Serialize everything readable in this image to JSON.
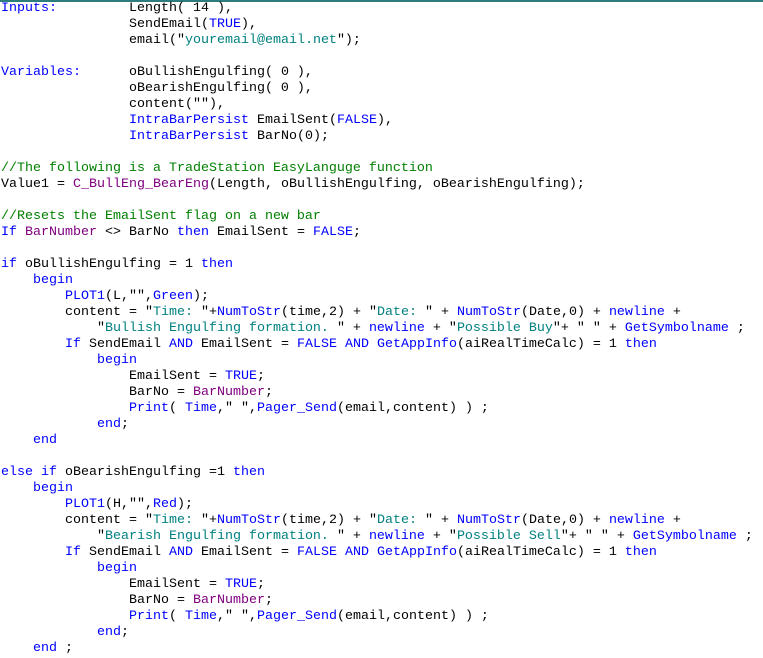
{
  "colors": {
    "keyword": "#0000ff",
    "string": "#008080",
    "comment": "#008000",
    "function": "#800080",
    "text": "#000000",
    "top_border": "#2e7d7d"
  },
  "code": {
    "lines": [
      [
        [
          "k",
          "Inputs:"
        ],
        [
          "t",
          "         Length( 14 ),"
        ]
      ],
      [
        [
          "t",
          "                SendEmail("
        ],
        [
          "k",
          "TRUE"
        ],
        [
          "t",
          "),"
        ]
      ],
      [
        [
          "t",
          "                email(\""
        ],
        [
          "s",
          "youremail@email.net"
        ],
        [
          "t",
          "\");"
        ]
      ],
      [],
      [
        [
          "k",
          "Variables:"
        ],
        [
          "t",
          "      oBullishEngulfing( 0 ),"
        ]
      ],
      [
        [
          "t",
          "                oBearishEngulfing( 0 ),"
        ]
      ],
      [
        [
          "t",
          "                content(\"\"),"
        ]
      ],
      [
        [
          "t",
          "                "
        ],
        [
          "k",
          "IntraBarPersist"
        ],
        [
          "t",
          " EmailSent("
        ],
        [
          "k",
          "FALSE"
        ],
        [
          "t",
          "),"
        ]
      ],
      [
        [
          "t",
          "                "
        ],
        [
          "k",
          "IntraBarPersist"
        ],
        [
          "t",
          " BarNo(0);"
        ]
      ],
      [],
      [
        [
          "c",
          "//The following is a TradeStation EasyLanguge function"
        ]
      ],
      [
        [
          "t",
          "Value1 = "
        ],
        [
          "f",
          "C_BullEng_BearEng"
        ],
        [
          "t",
          "(Length, oBullishEngulfing, oBearishEngulfing);"
        ]
      ],
      [],
      [
        [
          "c",
          "//Resets the EmailSent flag on a new bar"
        ]
      ],
      [
        [
          "k",
          "If"
        ],
        [
          "t",
          " "
        ],
        [
          "f",
          "BarNumber"
        ],
        [
          "t",
          " <> BarNo "
        ],
        [
          "k",
          "then"
        ],
        [
          "t",
          " EmailSent = "
        ],
        [
          "k",
          "FALSE"
        ],
        [
          "t",
          ";"
        ]
      ],
      [],
      [
        [
          "k",
          "if"
        ],
        [
          "t",
          " oBullishEngulfing = 1 "
        ],
        [
          "k",
          "then"
        ]
      ],
      [
        [
          "t",
          "    "
        ],
        [
          "k",
          "begin"
        ]
      ],
      [
        [
          "t",
          "        "
        ],
        [
          "k",
          "PLOT1"
        ],
        [
          "t",
          "(L,\"\","
        ],
        [
          "k",
          "Green"
        ],
        [
          "t",
          ");"
        ]
      ],
      [
        [
          "t",
          "        content = \""
        ],
        [
          "s",
          "Time: "
        ],
        [
          "t",
          "\"+"
        ],
        [
          "k",
          "NumToStr"
        ],
        [
          "t",
          "(time,2) + \""
        ],
        [
          "s",
          "Date: "
        ],
        [
          "t",
          "\" + "
        ],
        [
          "k",
          "NumToStr"
        ],
        [
          "t",
          "(Date,0) + "
        ],
        [
          "k",
          "newline"
        ],
        [
          "t",
          " +"
        ]
      ],
      [
        [
          "t",
          "            \""
        ],
        [
          "s",
          "Bullish Engulfing formation. "
        ],
        [
          "t",
          "\" + "
        ],
        [
          "k",
          "newline"
        ],
        [
          "t",
          " + \""
        ],
        [
          "s",
          "Possible Buy"
        ],
        [
          "t",
          "\"+ \" \" + "
        ],
        [
          "k",
          "GetSymbolname"
        ],
        [
          "t",
          " ;"
        ]
      ],
      [
        [
          "t",
          "        "
        ],
        [
          "k",
          "If"
        ],
        [
          "t",
          " SendEmail "
        ],
        [
          "k",
          "AND"
        ],
        [
          "t",
          " EmailSent = "
        ],
        [
          "k",
          "FALSE"
        ],
        [
          "t",
          " "
        ],
        [
          "k",
          "AND"
        ],
        [
          "t",
          " "
        ],
        [
          "k",
          "GetAppInfo"
        ],
        [
          "t",
          "(aiRealTimeCalc) = 1 "
        ],
        [
          "k",
          "then"
        ]
      ],
      [
        [
          "t",
          "            "
        ],
        [
          "k",
          "begin"
        ]
      ],
      [
        [
          "t",
          "                EmailSent = "
        ],
        [
          "k",
          "TRUE"
        ],
        [
          "t",
          ";"
        ]
      ],
      [
        [
          "t",
          "                BarNo = "
        ],
        [
          "f",
          "BarNumber"
        ],
        [
          "t",
          ";"
        ]
      ],
      [
        [
          "t",
          "                "
        ],
        [
          "k",
          "Print"
        ],
        [
          "t",
          "( "
        ],
        [
          "k",
          "Time"
        ],
        [
          "t",
          ",\" \","
        ],
        [
          "k",
          "Pager_Send"
        ],
        [
          "t",
          "(email,content) ) ;"
        ]
      ],
      [
        [
          "t",
          "            "
        ],
        [
          "k",
          "end"
        ],
        [
          "t",
          ";"
        ]
      ],
      [
        [
          "t",
          "    "
        ],
        [
          "k",
          "end"
        ]
      ],
      [],
      [
        [
          "k",
          "else if"
        ],
        [
          "t",
          " oBearishEngulfing =1 "
        ],
        [
          "k",
          "then"
        ]
      ],
      [
        [
          "t",
          "    "
        ],
        [
          "k",
          "begin"
        ]
      ],
      [
        [
          "t",
          "        "
        ],
        [
          "k",
          "PLOT1"
        ],
        [
          "t",
          "(H,\"\","
        ],
        [
          "k",
          "Red"
        ],
        [
          "t",
          ");"
        ]
      ],
      [
        [
          "t",
          "        content = \""
        ],
        [
          "s",
          "Time: "
        ],
        [
          "t",
          "\"+"
        ],
        [
          "k",
          "NumToStr"
        ],
        [
          "t",
          "(time,2) + \""
        ],
        [
          "s",
          "Date: "
        ],
        [
          "t",
          "\" + "
        ],
        [
          "k",
          "NumToStr"
        ],
        [
          "t",
          "(Date,0) + "
        ],
        [
          "k",
          "newline"
        ],
        [
          "t",
          " +"
        ]
      ],
      [
        [
          "t",
          "            \""
        ],
        [
          "s",
          "Bearish Engulfing formation. "
        ],
        [
          "t",
          "\" + "
        ],
        [
          "k",
          "newline"
        ],
        [
          "t",
          " + \""
        ],
        [
          "s",
          "Possible Sell"
        ],
        [
          "t",
          "\"+ \" \" + "
        ],
        [
          "k",
          "GetSymbolname"
        ],
        [
          "t",
          " ;"
        ]
      ],
      [
        [
          "t",
          "        "
        ],
        [
          "k",
          "If"
        ],
        [
          "t",
          " SendEmail "
        ],
        [
          "k",
          "AND"
        ],
        [
          "t",
          " EmailSent = "
        ],
        [
          "k",
          "FALSE"
        ],
        [
          "t",
          " "
        ],
        [
          "k",
          "AND"
        ],
        [
          "t",
          " "
        ],
        [
          "k",
          "GetAppInfo"
        ],
        [
          "t",
          "(aiRealTimeCalc) = 1 "
        ],
        [
          "k",
          "then"
        ]
      ],
      [
        [
          "t",
          "            "
        ],
        [
          "k",
          "begin"
        ]
      ],
      [
        [
          "t",
          "                EmailSent = "
        ],
        [
          "k",
          "TRUE"
        ],
        [
          "t",
          ";"
        ]
      ],
      [
        [
          "t",
          "                BarNo = "
        ],
        [
          "f",
          "BarNumber"
        ],
        [
          "t",
          ";"
        ]
      ],
      [
        [
          "t",
          "                "
        ],
        [
          "k",
          "Print"
        ],
        [
          "t",
          "( "
        ],
        [
          "k",
          "Time"
        ],
        [
          "t",
          ",\" \","
        ],
        [
          "k",
          "Pager_Send"
        ],
        [
          "t",
          "(email,content) ) ;"
        ]
      ],
      [
        [
          "t",
          "            "
        ],
        [
          "k",
          "end"
        ],
        [
          "t",
          ";"
        ]
      ],
      [
        [
          "t",
          "    "
        ],
        [
          "k",
          "end"
        ],
        [
          "t",
          " ;"
        ]
      ]
    ]
  }
}
